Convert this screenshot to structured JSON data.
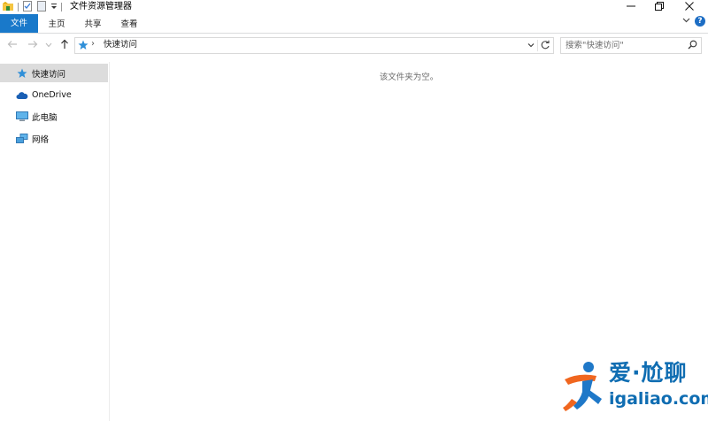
{
  "window": {
    "title": "文件资源管理器",
    "controls": [
      "minimize-icon",
      "restore-icon",
      "close-icon"
    ]
  },
  "quick_access_toolbar": [
    "folder-home-icon",
    "properties-icon",
    "new-folder-icon",
    "customize-dropdown-icon"
  ],
  "ribbon": {
    "tabs": [
      {
        "label": "文件",
        "active": true
      },
      {
        "label": "主页"
      },
      {
        "label": "共享"
      },
      {
        "label": "查看"
      }
    ],
    "help_label": "?"
  },
  "navigation": {
    "back_icon": "arrow-left-icon",
    "forward_icon": "arrow-right-icon",
    "recent_icon": "chevron-down-icon",
    "up_icon": "arrow-up-icon"
  },
  "address_bar": {
    "separator": "›",
    "path": "快速访问"
  },
  "search": {
    "placeholder": "搜索\"快速访问\""
  },
  "nav_pane": {
    "items": [
      {
        "label": "快速访问",
        "icon": "star-icon",
        "selected": true
      },
      {
        "label": "OneDrive",
        "icon": "cloud-icon"
      },
      {
        "label": "此电脑",
        "icon": "computer-icon"
      },
      {
        "label": "网络",
        "icon": "network-icon"
      }
    ]
  },
  "content": {
    "empty_message": "该文件夹为空。"
  },
  "watermark": {
    "brand": "爱·尬聊",
    "url": "igaliao.com"
  },
  "colors": {
    "accent": "#1979ca",
    "selection": "#dcdcdc",
    "watermark_blue": "#0f6db2",
    "watermark_orange": "#f0661f"
  }
}
